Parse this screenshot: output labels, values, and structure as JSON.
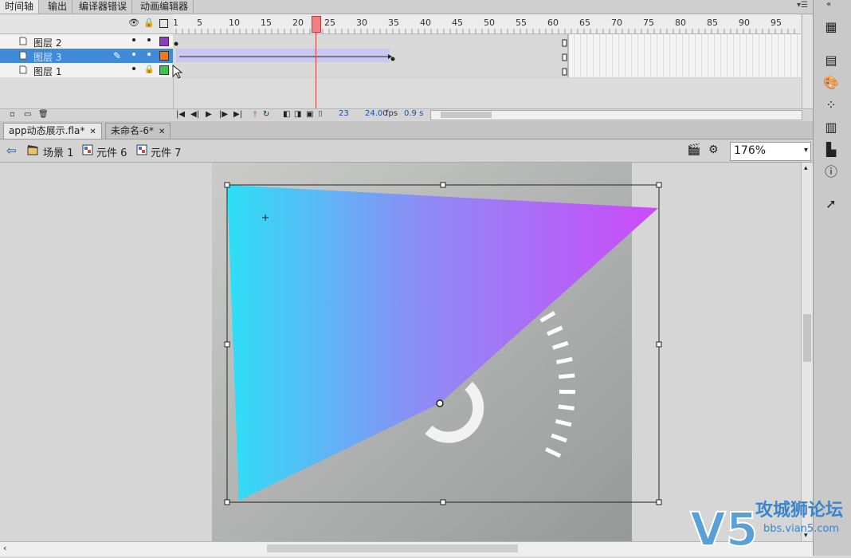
{
  "panel_tabs": [
    "时间轴",
    "输出",
    "编译器错误",
    "动画编辑器"
  ],
  "panel_menu_icon": "panel-menu-icon",
  "layers": [
    {
      "name": "图层 2",
      "color": "#8a3fc6",
      "selected": false
    },
    {
      "name": "图层 3",
      "color": "#f07a1a",
      "selected": true
    },
    {
      "name": "图层 1",
      "color": "#3ec24a",
      "selected": false
    }
  ],
  "ruler_labels": [
    "1",
    "5",
    "10",
    "15",
    "20",
    "25",
    "30",
    "35",
    "40",
    "45",
    "50",
    "55",
    "60",
    "65",
    "70",
    "75",
    "80",
    "85",
    "90",
    "95"
  ],
  "playhead_frame": 23,
  "timeline_status": {
    "frame": "23",
    "fps": "24.00",
    "fps_unit": "fps",
    "time": "0.9 s"
  },
  "doc_tabs": [
    {
      "label": "app动态展示.fla*",
      "active": true
    },
    {
      "label": "未命名-6*",
      "active": false
    }
  ],
  "breadcrumbs": [
    "场景 1",
    "元件 6",
    "元件 7"
  ],
  "zoom": "176%",
  "watermark": {
    "brand": "V5",
    "text": "攻城狮论坛",
    "url": "bbs.vian5.com"
  },
  "colors": {
    "gradient_start": "#2de0f6",
    "gradient_end": "#cc4af9",
    "gauge_ticks": "#ffffff",
    "selection": "#3f8bd9",
    "playhead": "#f08080"
  }
}
